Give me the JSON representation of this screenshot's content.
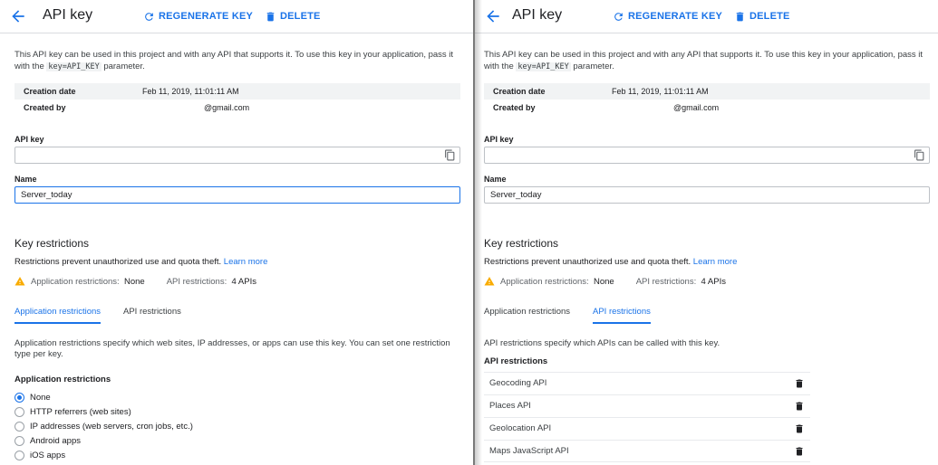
{
  "left": {
    "title": "API key",
    "regenerate_label": "REGENERATE KEY",
    "delete_label": "DELETE",
    "description_pre": "This API key can be used in this project and with any API that supports it. To use this key in your application, pass it with the ",
    "description_code": "key=API_KEY",
    "description_post": " parameter.",
    "creation_date_label": "Creation date",
    "creation_date_value": "Feb 11, 2019, 11:01:11 AM",
    "created_by_label": "Created by",
    "created_by_value": "@gmail.com",
    "api_key_label": "API key",
    "api_key_value": "",
    "name_label": "Name",
    "name_value": "Server_today",
    "key_restrictions_title": "Key restrictions",
    "restrictions_text": "Restrictions prevent unauthorized use and quota theft.",
    "learn_more": "Learn more",
    "app_restr_label": "Application restrictions:",
    "app_restr_value": "None",
    "api_restr_label": "API restrictions:",
    "api_restr_value": "4 APIs",
    "tab_app": "Application restrictions",
    "tab_api": "API restrictions",
    "tab_desc": "Application restrictions specify which web sites, IP addresses, or apps can use this key. You can set one restriction type per key.",
    "app_restrictions_heading": "Application restrictions",
    "radio_options": [
      "None",
      "HTTP referrers (web sites)",
      "IP addresses (web servers, cron jobs, etc.)",
      "Android apps",
      "iOS apps"
    ],
    "radio_selected": "None"
  },
  "right": {
    "title": "API key",
    "regenerate_label": "REGENERATE KEY",
    "delete_label": "DELETE",
    "description_pre": "This API key can be used in this project and with any API that supports it. To use this key in your application, pass it with the ",
    "description_code": "key=API_KEY",
    "description_post": " parameter.",
    "creation_date_label": "Creation date",
    "creation_date_value": "Feb 11, 2019, 11:01:11 AM",
    "created_by_label": "Created by",
    "created_by_value": "@gmail.com",
    "api_key_label": "API key",
    "api_key_value": "",
    "name_label": "Name",
    "name_value": "Server_today",
    "key_restrictions_title": "Key restrictions",
    "restrictions_text": "Restrictions prevent unauthorized use and quota theft.",
    "learn_more": "Learn more",
    "app_restr_label": "Application restrictions:",
    "app_restr_value": "None",
    "api_restr_label": "API restrictions:",
    "api_restr_value": "4 APIs",
    "tab_app": "Application restrictions",
    "tab_api": "API restrictions",
    "tab_desc": "API restrictions specify which APIs can be called with this key.",
    "api_restrictions_heading": "API restrictions",
    "apis": [
      "Geocoding API",
      "Places API",
      "Geolocation API",
      "Maps JavaScript API"
    ]
  },
  "colors": {
    "accent": "#1a73e8",
    "warning": "#f9ab00",
    "text": "#202124"
  },
  "icons": {
    "back": "arrow-left-icon",
    "regenerate": "refresh-icon",
    "delete": "trash-icon",
    "copy": "copy-icon",
    "warning": "warning-icon"
  }
}
